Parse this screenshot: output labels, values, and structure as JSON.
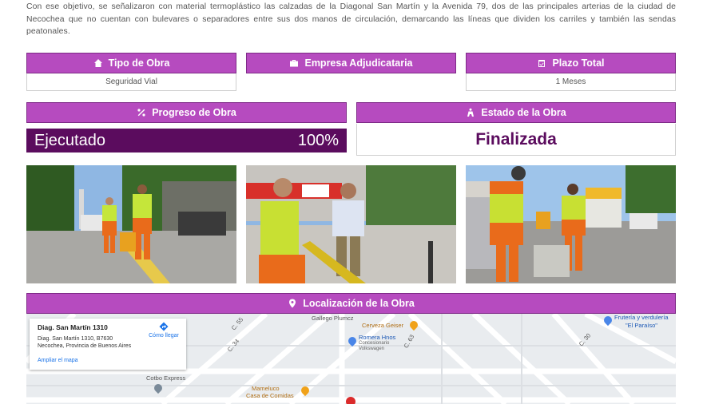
{
  "intro_text": "Con ese objetivo, se señalizaron con material termoplástico las calzadas de la Diagonal San Martín y la Avenida 79, dos de las principales arterias de la ciudad de Necochea que no cuentan con bulevares o separadores entre sus dos manos de circulación, demarcando las líneas que dividen los carriles y también las sendas peatonales.",
  "info": {
    "tipo": {
      "label": "Tipo de Obra",
      "value": "Seguridad Vial",
      "icon": "house-icon"
    },
    "empresa": {
      "label": "Empresa Adjudicataria",
      "value": "",
      "icon": "briefcase-icon"
    },
    "plazo": {
      "label": "Plazo Total",
      "value": "1 Meses",
      "icon": "calendar-check-icon"
    }
  },
  "progress": {
    "label": "Progreso de Obra",
    "status_text": "Ejecutado",
    "percent_text": "100%",
    "percent": 1.0,
    "icon": "percent-icon"
  },
  "estado": {
    "label": "Estado de la Obra",
    "value": "Finalizada",
    "icon": "road-worker-icon"
  },
  "photos": [
    "photo-1-road-workers",
    "photo-2-officials-inspecting",
    "photo-3-painting-lines"
  ],
  "location": {
    "label": "Localización de la Obra",
    "icon": "map-marker-icon",
    "place_title": "Diag. San Martín 1310",
    "address_line1": "Diag. San Martín 1310, B7630",
    "address_line2": "Necochea, Provincia de Buenos Aires",
    "directions_label": "Cómo llegar",
    "enlarge_label": "Ampliar el mapa",
    "labels": {
      "gallego": "Gallego Plumcz",
      "cerveza": "Cerveza Geiser",
      "romera": "Romera Hnos",
      "romera_sub": "Concesionario",
      "romera_sub2": "Volkswagen",
      "fruteria": "Frutería y verdulería",
      "paraiso": "\"El Paraíso\"",
      "cotbo": "Cotbo Express",
      "mameluco": "Mameluco",
      "comidas": "Casa de Comidas",
      "c55": "C. 55",
      "c34": "C. 34",
      "c63": "C. 63",
      "c30": "C. 30"
    }
  },
  "colors": {
    "accent": "#b64bbf",
    "dark": "#5b0c5e"
  }
}
